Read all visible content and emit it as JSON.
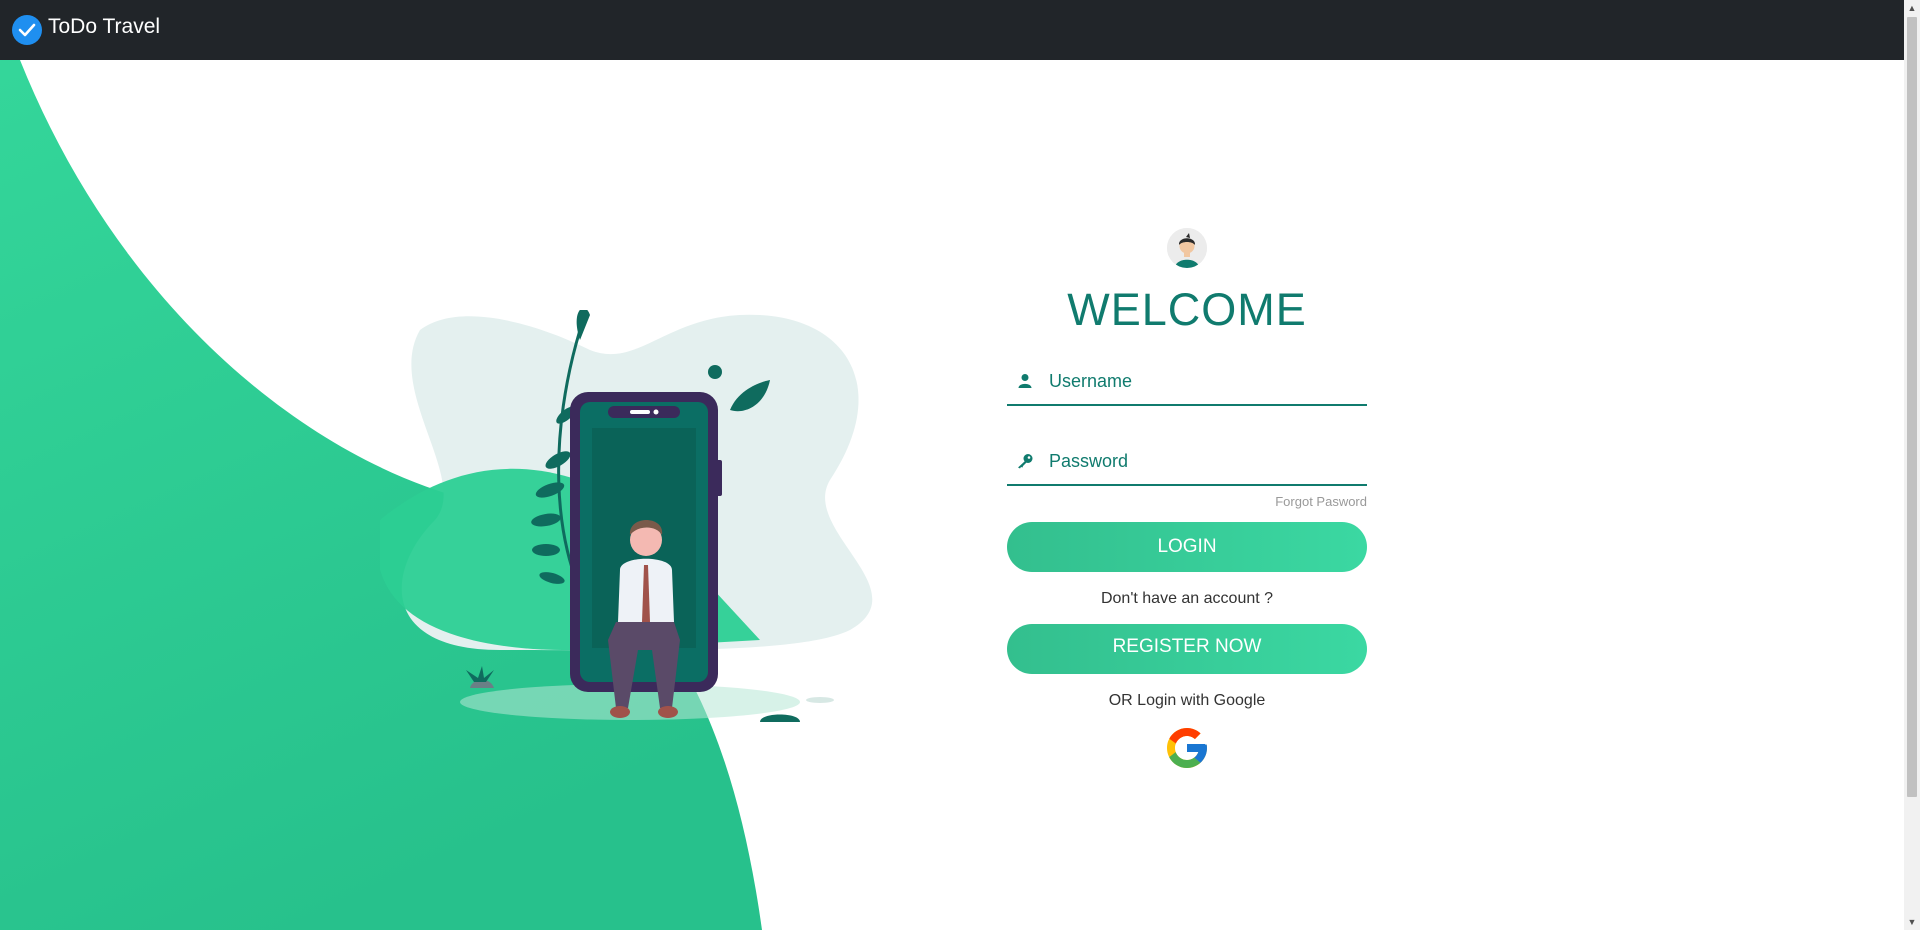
{
  "navbar": {
    "brand": "ToDo Travel",
    "brand_icon": "check-circle-icon"
  },
  "login": {
    "title": "WELCOME",
    "username_placeholder": "Username",
    "password_placeholder": "Password",
    "forgot_label": "Forgot Pasword",
    "login_label": "LOGIN",
    "no_account_text": "Don't have an account ?",
    "register_label": "REGISTER NOW",
    "google_text": "OR Login with Google"
  },
  "colors": {
    "accent": "#107b6e",
    "button_gradient_start": "#33bf8e",
    "button_gradient_end": "#3bd8a2",
    "background_wave": "#2fd194",
    "navbar": "#212529"
  }
}
